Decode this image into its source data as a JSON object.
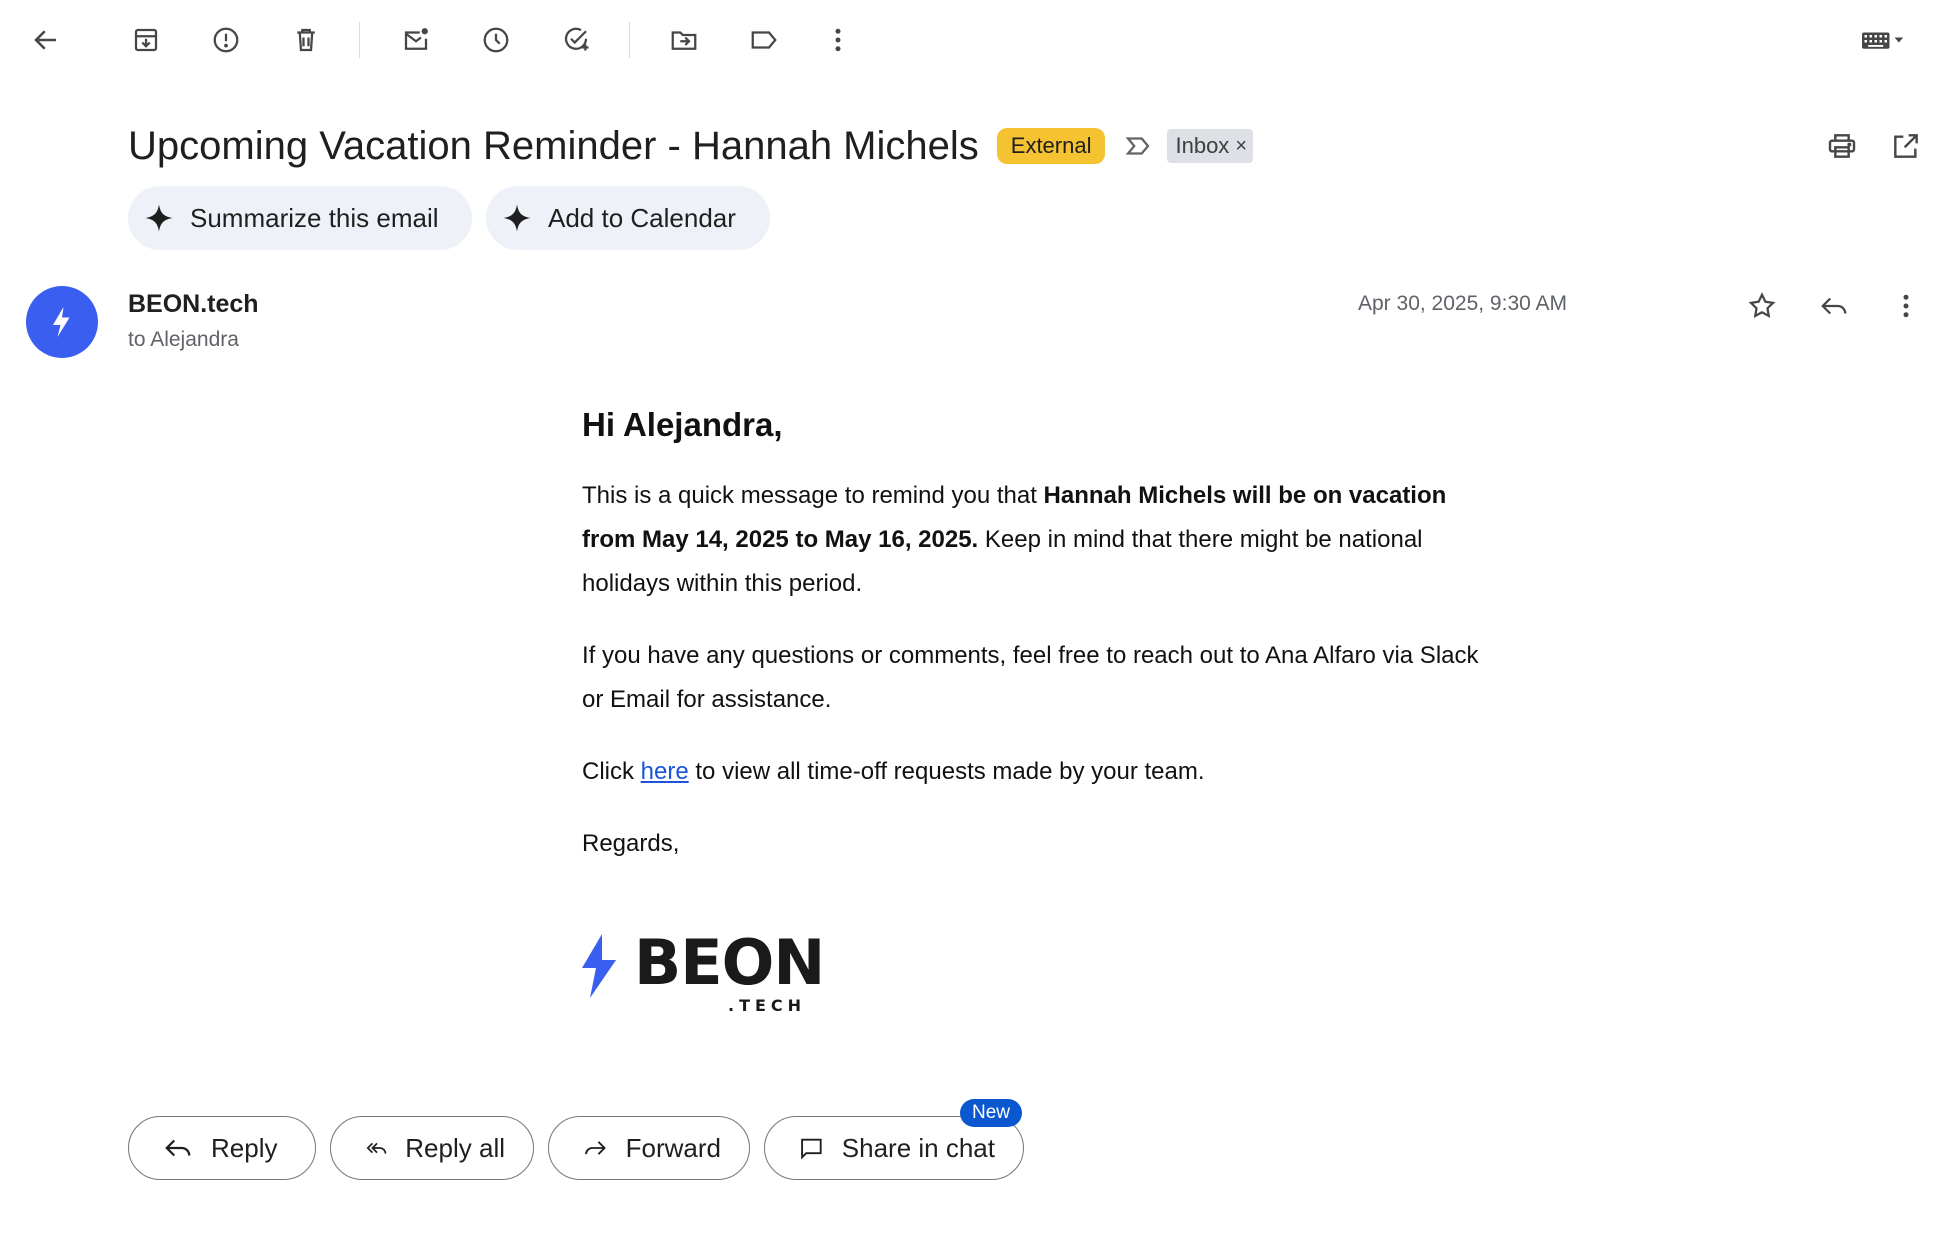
{
  "toolbar": {
    "icons": [
      "back-arrow-icon",
      "archive-icon",
      "report-spam-icon",
      "delete-icon",
      "mark-unread-icon",
      "snooze-icon",
      "add-to-tasks-icon",
      "move-to-icon",
      "label-icon",
      "more-vert-icon",
      "keyboard-icon"
    ]
  },
  "email": {
    "subject": "Upcoming Vacation Reminder - Hannah Michels",
    "external_badge": "External",
    "inbox_chip": "Inbox",
    "inbox_chip_close": "×"
  },
  "ai_actions": {
    "summarize": "Summarize this email",
    "calendar": "Add to Calendar"
  },
  "message": {
    "sender": "BEON.tech",
    "to": "to Alejandra",
    "date": "Apr 30, 2025, 9:30 AM"
  },
  "body": {
    "greeting": "Hi Alejandra,",
    "p1_start": "This is a quick message to remind you that ",
    "p1_bold": "Hannah Michels will be on vacation from May 14, 2025 to May 16, 2025.",
    "p1_end": " Keep in mind that there might be national holidays within this period.",
    "p2": "If you have any questions or comments, feel free to reach out to Ana Alfaro via Slack or Email for assistance.",
    "p3_start": "Click ",
    "p3_link": "here",
    "p3_end": " to view all time-off requests made by your team.",
    "closing": "Regards,"
  },
  "logo": {
    "text": "BEON",
    "sub": ".TECH",
    "accent_color": "#3a5ef0"
  },
  "actions": {
    "reply": "Reply",
    "reply_all": "Reply all",
    "forward": "Forward",
    "share_in_chat": "Share in chat",
    "new_badge": "New"
  },
  "colors": {
    "external_badge": "#f5c332",
    "avatar": "#3a5ef0",
    "link": "#1a56db",
    "new_badge": "#0b57d0"
  }
}
